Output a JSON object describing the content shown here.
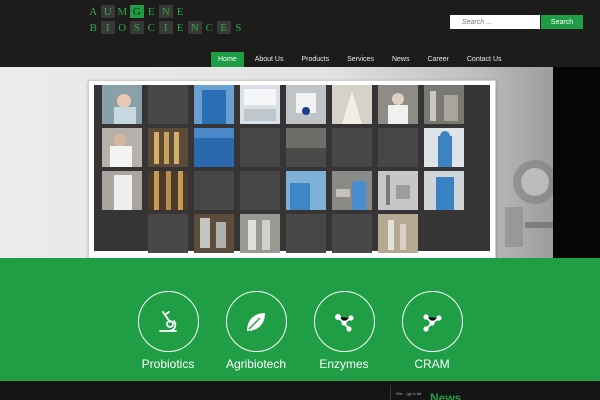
{
  "brand": {
    "row1": [
      "A",
      "U",
      "M",
      "G",
      "E",
      "N",
      "E"
    ],
    "row2": [
      "B",
      "I",
      "O",
      "S",
      "C",
      "I",
      "E",
      "N",
      "C",
      "E",
      "S"
    ],
    "color": "#1f9e45"
  },
  "search": {
    "placeholder": "Search ...",
    "button": "Search"
  },
  "nav": [
    "Home",
    "About Us",
    "Products",
    "Services",
    "News",
    "Career",
    "Contact Us"
  ],
  "services": [
    {
      "label": "Probiotics",
      "icon": "microscope-icon"
    },
    {
      "label": "Agribiotech",
      "icon": "leaf-icon"
    },
    {
      "label": "Enzymes",
      "icon": "molecule-icon"
    },
    {
      "label": "CRAM",
      "icon": "molecule-icon"
    }
  ],
  "footer": {
    "small": "We... (g) to fat",
    "news": "News"
  }
}
